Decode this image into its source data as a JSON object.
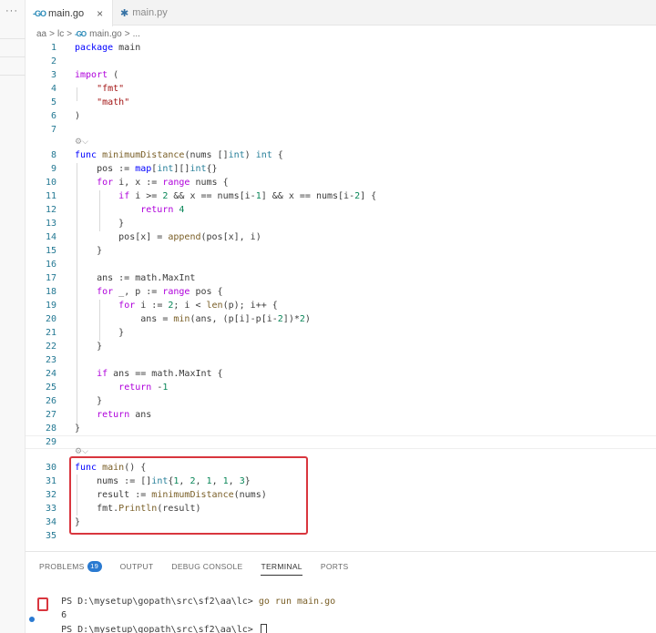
{
  "left_strip": {
    "more_label": "···"
  },
  "tabs": [
    {
      "label": "main.go",
      "icon": "go-file-icon",
      "active": true
    },
    {
      "label": "main.py",
      "icon": "python-file-icon",
      "active": false
    }
  ],
  "breadcrumb": {
    "root": "aa",
    "folder": "lc",
    "file": "main.go",
    "tail": "..."
  },
  "code_lines": [
    {
      "n": "1",
      "html": "<span class=\"kw\">package</span> main"
    },
    {
      "n": "2",
      "html": ""
    },
    {
      "n": "3",
      "html": "<span class=\"kw2\">import</span> ("
    },
    {
      "n": "4",
      "html": "    <span class=\"str\">\"fmt\"</span>"
    },
    {
      "n": "5",
      "html": "    <span class=\"str\">\"math\"</span>"
    },
    {
      "n": "6",
      "html": ")"
    },
    {
      "n": "7",
      "html": ""
    },
    {
      "n": "8",
      "html": "<span class=\"kw\">func</span> <span class=\"fn\">minimumDistance</span>(nums []<span class=\"ty\">int</span>) <span class=\"ty\">int</span> {"
    },
    {
      "n": "9",
      "html": "    pos := <span class=\"kw\">map</span>[<span class=\"ty\">int</span>][]<span class=\"ty\">int</span>{}"
    },
    {
      "n": "10",
      "html": "    <span class=\"kw2\">for</span> i, x := <span class=\"kw2\">range</span> nums {"
    },
    {
      "n": "11",
      "html": "        <span class=\"kw2\">if</span> i >= <span class=\"num\">2</span> && x == nums[i-<span class=\"num\">1</span>] && x == nums[i-<span class=\"num\">2</span>] {"
    },
    {
      "n": "12",
      "html": "            <span class=\"kw2\">return</span> <span class=\"num\">4</span>"
    },
    {
      "n": "13",
      "html": "        }"
    },
    {
      "n": "14",
      "html": "        pos[x] = <span class=\"fn\">append</span>(pos[x], i)"
    },
    {
      "n": "15",
      "html": "    }"
    },
    {
      "n": "16",
      "html": ""
    },
    {
      "n": "17",
      "html": "    ans := math.MaxInt"
    },
    {
      "n": "18",
      "html": "    <span class=\"kw2\">for</span> _, p := <span class=\"kw2\">range</span> pos {"
    },
    {
      "n": "19",
      "html": "        <span class=\"kw2\">for</span> i := <span class=\"num\">2</span>; i < <span class=\"fn\">len</span>(p); i++ {"
    },
    {
      "n": "20",
      "html": "            ans = <span class=\"fn\">min</span>(ans, (p[i]-p[i-<span class=\"num\">2</span>])*<span class=\"num\">2</span>)"
    },
    {
      "n": "21",
      "html": "        }"
    },
    {
      "n": "22",
      "html": "    }"
    },
    {
      "n": "23",
      "html": ""
    },
    {
      "n": "24",
      "html": "    <span class=\"kw2\">if</span> ans == math.MaxInt {"
    },
    {
      "n": "25",
      "html": "        <span class=\"kw2\">return</span> -<span class=\"num\">1</span>"
    },
    {
      "n": "26",
      "html": "    }"
    },
    {
      "n": "27",
      "html": "    <span class=\"kw2\">return</span> ans"
    },
    {
      "n": "28",
      "html": "}"
    },
    {
      "n": "29",
      "html": ""
    },
    {
      "n": "30",
      "html": "<span class=\"kw\">func</span> <span class=\"fn\">main</span>() {"
    },
    {
      "n": "31",
      "html": "    nums := []<span class=\"ty\">int</span>{<span class=\"num\">1</span>, <span class=\"num\">2</span>, <span class=\"num\">1</span>, <span class=\"num\">1</span>, <span class=\"num\">3</span>}"
    },
    {
      "n": "32",
      "html": "    result := <span class=\"fn\">minimumDistance</span>(nums)"
    },
    {
      "n": "33",
      "html": "    fmt.<span class=\"fn\">Println</span>(result)"
    },
    {
      "n": "34",
      "html": "}"
    },
    {
      "n": "35",
      "html": ""
    }
  ],
  "panel": {
    "tabs": [
      {
        "label": "PROBLEMS",
        "badge": "19"
      },
      {
        "label": "OUTPUT"
      },
      {
        "label": "DEBUG CONSOLE"
      },
      {
        "label": "TERMINAL",
        "active": true
      },
      {
        "label": "PORTS"
      }
    ],
    "terminal": {
      "prompt1": "PS D:\\mysetup\\gopath\\src\\sf2\\aa\\lc> ",
      "command1": "go run main.go",
      "output": "6",
      "prompt2": "PS D:\\mysetup\\gopath\\src\\sf2\\aa\\lc> "
    }
  },
  "colors": {
    "accent": "#2a7ad1",
    "highlight": "#d9363e"
  }
}
